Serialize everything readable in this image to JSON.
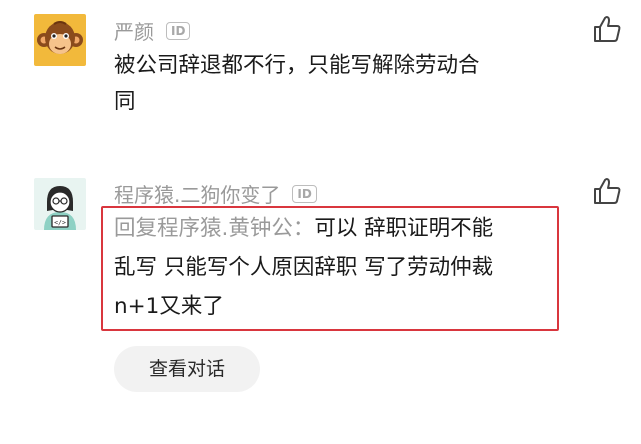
{
  "comments": [
    {
      "username": "严颜",
      "id_badge": "ID",
      "avatar_icon": "monkey-avatar-icon",
      "like_icon": "thumbs-up-icon",
      "text_line1": "被公司辞退都不行，只能写解除劳动合",
      "text_line2": "同"
    },
    {
      "username": "程序猿.二狗你变了",
      "id_badge": "ID",
      "avatar_icon": "programmer-avatar-icon",
      "like_icon": "thumbs-up-icon",
      "reply_prefix": "回复程序猿.黄钟公：",
      "reply_line1": "可以 辞职证明不能",
      "reply_line2": "乱写 只能写个人原因辞职 写了劳动仲裁",
      "reply_line3": "n+1又来了",
      "view_conversation_label": "查看对话"
    }
  ],
  "colors": {
    "highlight_border": "#d9363e",
    "username": "#9a9a9a",
    "button_bg": "#f2f2f2"
  }
}
